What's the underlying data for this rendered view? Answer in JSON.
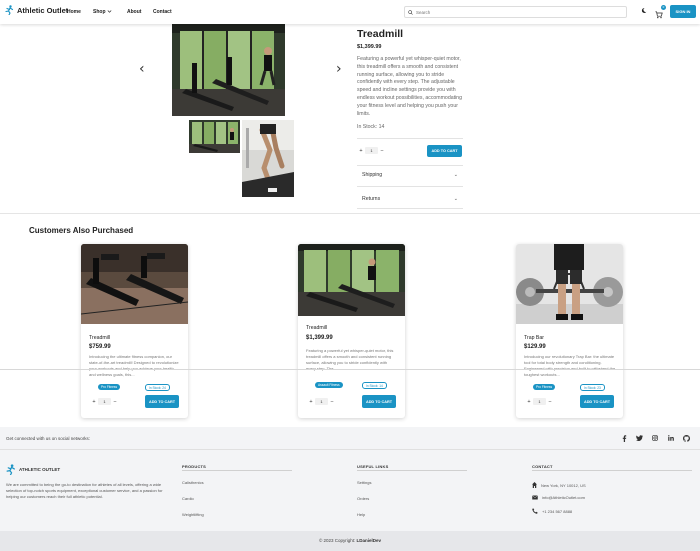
{
  "nav": {
    "brand": "Athletic Outlet",
    "links": [
      "Home",
      "Shop",
      "About",
      "Contact"
    ],
    "search_placeholder": "Search",
    "cart_count": "0",
    "signin": "SIGN IN"
  },
  "product": {
    "title": "Treadmill",
    "price": "$1,399.99",
    "description": "Featuring a powerful yet whisper-quiet motor, this treadmill offers a smooth and consistent running surface, allowing you to stride confidently with every step. The adjustable speed and incline settings provide you with endless workout possibilities, accommodating your fitness level and helping you push your limits.",
    "stock": "In Stock: 14",
    "qty": "1",
    "add_to_cart": "ADD TO CART",
    "accordions": [
      "Shipping",
      "Returns"
    ]
  },
  "related": {
    "title": "Customers Also Purchased",
    "cards": [
      {
        "name": "Treadmill",
        "price": "$759.99",
        "desc": "Introducing the ultimate fitness companion, our state-of-the-art treadmill! Designed to revolutionize your workouts and help you achieve your health and wellness goals, this...",
        "category": "Pro Fitness",
        "stock": "In Stock: 24",
        "qty": "1",
        "btn": "ADD TO CART"
      },
      {
        "name": "Treadmill",
        "price": "$1,399.99",
        "desc": "Featuring a powerful yet whisper-quiet motor, this treadmill offers a smooth and consistent running surface, allowing you to stride confidently with every step. The...",
        "category": "Assault Fitness",
        "stock": "In Stock: 14",
        "qty": "1",
        "btn": "ADD TO CART"
      },
      {
        "name": "Trap Bar",
        "price": "$129.99",
        "desc": "Introducing our revolutionary Trap Bar: the ultimate tool for total body strength and conditioning. Engineered with precision and built to withstand the toughest workouts...",
        "category": "Pro Fitness",
        "stock": "In Stock: 23",
        "qty": "1",
        "btn": "ADD TO CART"
      }
    ]
  },
  "footer": {
    "social_text": "Get connected with us on social networks:",
    "social_icons": [
      "facebook-icon",
      "twitter-icon",
      "instagram-icon",
      "linkedin-icon",
      "github-icon"
    ],
    "brand": "ATHLETIC OUTLET",
    "about": "We are committed to being the go-to destination for athletes of all levels, offering a wide selection of top-notch sports equipment, exceptional customer service, and a passion for helping our customers reach their full athletic potential.",
    "products_head": "PRODUCTS",
    "products": [
      "Calisthenics",
      "Cardio",
      "Weightlifting"
    ],
    "useful_head": "USEFUL LINKS",
    "useful": [
      "Settings",
      "Orders",
      "Help"
    ],
    "contact_head": "CONTACT",
    "contact": [
      "New York, NY 10012, US",
      "info@AthleticOutlet.com",
      "+1 234 567 8888"
    ],
    "copyright_prefix": "© 2023 Copyright:",
    "copyright_name": "LDanielDev"
  },
  "colors": {
    "accent": "#1a93c4"
  }
}
